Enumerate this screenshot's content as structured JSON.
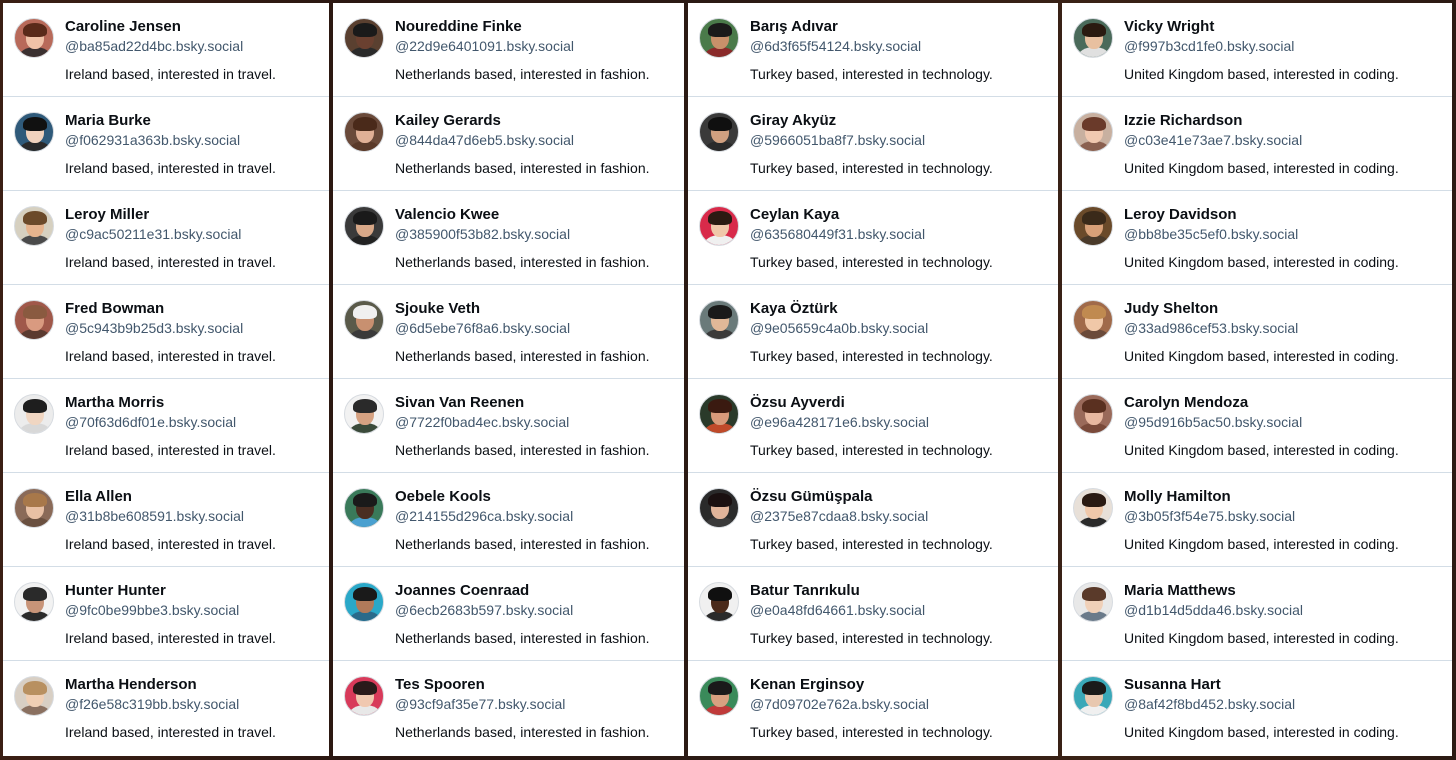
{
  "columns": [
    {
      "accounts": [
        {
          "name": "Caroline Jensen",
          "handle": "@ba85ad22d4bc.bsky.social",
          "bio": "Ireland based, interested in travel.",
          "avatar": {
            "bg": "#b86a5a",
            "skin": "#f0c2a8",
            "hair": "#5a2a1a",
            "shirt": "#3a3030"
          }
        },
        {
          "name": "Maria Burke",
          "handle": "@f062931a363b.bsky.social",
          "bio": "Ireland based, interested in travel.",
          "avatar": {
            "bg": "#2f5a7a",
            "skin": "#f1d2bd",
            "hair": "#111111",
            "shirt": "#2a2a2a"
          }
        },
        {
          "name": "Leroy Miller",
          "handle": "@c9ac50211e31.bsky.social",
          "bio": "Ireland based, interested in travel.",
          "avatar": {
            "bg": "#d6d0c0",
            "skin": "#e6b48e",
            "hair": "#6b4a2a",
            "shirt": "#4a4a4a"
          }
        },
        {
          "name": "Fred Bowman",
          "handle": "@5c943b9b25d3.bsky.social",
          "bio": "Ireland based, interested in travel.",
          "avatar": {
            "bg": "#a0584a",
            "skin": "#d99a80",
            "hair": "#8a5a40",
            "shirt": "#5a3a30"
          }
        },
        {
          "name": "Martha Morris",
          "handle": "@70f63d6df01e.bsky.social",
          "bio": "Ireland based, interested in travel.",
          "avatar": {
            "bg": "#ececec",
            "skin": "#f0d6c2",
            "hair": "#1e1e1e",
            "shirt": "#d8d8d8"
          }
        },
        {
          "name": "Ella Allen",
          "handle": "@31b8be608591.bsky.social",
          "bio": "Ireland based, interested in travel.",
          "avatar": {
            "bg": "#8a6a58",
            "skin": "#e8c0a4",
            "hair": "#a8784a",
            "shirt": "#6a5040"
          }
        },
        {
          "name": "Hunter Hunter",
          "handle": "@9fc0be99bbe3.bsky.social",
          "bio": "Ireland based, interested in travel.",
          "avatar": {
            "bg": "#f2f2f2",
            "skin": "#c89478",
            "hair": "#2a2a2a",
            "shirt": "#2a2a2a"
          }
        },
        {
          "name": "Martha Henderson",
          "handle": "@f26e58c319bb.bsky.social",
          "bio": "Ireland based, interested in travel.",
          "avatar": {
            "bg": "#d8cfc4",
            "skin": "#f0cfb4",
            "hair": "#b89060",
            "shirt": "#8a7060"
          }
        }
      ]
    },
    {
      "accounts": [
        {
          "name": "Noureddine Finke",
          "handle": "@22d9e6401091.bsky.social",
          "bio": "Netherlands based, interested in fashion.",
          "avatar": {
            "bg": "#5a4030",
            "skin": "#6a4030",
            "hair": "#1a1a1a",
            "shirt": "#2a2a2a"
          }
        },
        {
          "name": "Kailey Gerards",
          "handle": "@844da47d6eb5.bsky.social",
          "bio": "Netherlands based, interested in fashion.",
          "avatar": {
            "bg": "#6a4a3a",
            "skin": "#e0b096",
            "hair": "#4a2a1a",
            "shirt": "#5a3a2a"
          }
        },
        {
          "name": "Valencio Kwee",
          "handle": "@385900f53b82.bsky.social",
          "bio": "Netherlands based, interested in fashion.",
          "avatar": {
            "bg": "#3a3a3a",
            "skin": "#d8a888",
            "hair": "#1a1a1a",
            "shirt": "#222222"
          }
        },
        {
          "name": "Sjouke Veth",
          "handle": "@6d5ebe76f8a6.bsky.social",
          "bio": "Netherlands based, interested in fashion.",
          "avatar": {
            "bg": "#5a5a4a",
            "skin": "#c89070",
            "hair": "#f0f0f0",
            "shirt": "#3a3a3a"
          }
        },
        {
          "name": "Sivan Van Reenen",
          "handle": "@7722f0bad4ec.bsky.social",
          "bio": "Netherlands based, interested in fashion.",
          "avatar": {
            "bg": "#f2f2f2",
            "skin": "#d6a282",
            "hair": "#2a2a2a",
            "shirt": "#3a4a3a"
          }
        },
        {
          "name": "Oebele Kools",
          "handle": "@214155d296ca.bsky.social",
          "bio": "Netherlands based, interested in fashion.",
          "avatar": {
            "bg": "#3a7a5a",
            "skin": "#4a2e22",
            "hair": "#1a1a1a",
            "shirt": "#4aa0d0"
          }
        },
        {
          "name": "Joannes Coenraad",
          "handle": "@6ecb2683b597.bsky.social",
          "bio": "Netherlands based, interested in fashion.",
          "avatar": {
            "bg": "#2aa8c8",
            "skin": "#b07a5a",
            "hair": "#1a1a1a",
            "shirt": "#2a6a8a"
          }
        },
        {
          "name": "Tes Spooren",
          "handle": "@93cf9af35e77.bsky.social",
          "bio": "Netherlands based, interested in fashion.",
          "avatar": {
            "bg": "#d83a5a",
            "skin": "#f0c8b0",
            "hair": "#2a1a1a",
            "shirt": "#e8e8e8"
          }
        }
      ]
    },
    {
      "accounts": [
        {
          "name": "Barış Adıvar",
          "handle": "@6d3f65f54124.bsky.social",
          "bio": "Turkey based, interested in technology.",
          "avatar": {
            "bg": "#4a7a4a",
            "skin": "#c8906a",
            "hair": "#1a1a1a",
            "shirt": "#8a2a2a"
          }
        },
        {
          "name": "Giray Akyüz",
          "handle": "@5966051ba8f7.bsky.social",
          "bio": "Turkey based, interested in technology.",
          "avatar": {
            "bg": "#3a3a3a",
            "skin": "#d0a080",
            "hair": "#101010",
            "shirt": "#2a2a2a"
          }
        },
        {
          "name": "Ceylan Kaya",
          "handle": "@635680449f31.bsky.social",
          "bio": "Turkey based, interested in technology.",
          "avatar": {
            "bg": "#d82a4a",
            "skin": "#f0c8aa",
            "hair": "#2a1a12",
            "shirt": "#f0f0f0"
          }
        },
        {
          "name": "Kaya Öztürk",
          "handle": "@9e05659c4a0b.bsky.social",
          "bio": "Turkey based, interested in technology.",
          "avatar": {
            "bg": "#6a7a7a",
            "skin": "#e0b898",
            "hair": "#1a1a1a",
            "shirt": "#3a3a3a"
          }
        },
        {
          "name": "Özsu Ayverdi",
          "handle": "@e96a428171e6.bsky.social",
          "bio": "Turkey based, interested in technology.",
          "avatar": {
            "bg": "#2a3a2a",
            "skin": "#d89a7a",
            "hair": "#3a1a10",
            "shirt": "#c04a2a"
          }
        },
        {
          "name": "Özsu Gümüşpala",
          "handle": "@2375e87cdaa8.bsky.social",
          "bio": "Turkey based, interested in technology.",
          "avatar": {
            "bg": "#2a2a2a",
            "skin": "#e0b49a",
            "hair": "#1a1010",
            "shirt": "#3a3a3a"
          }
        },
        {
          "name": "Batur Tanrıkulu",
          "handle": "@e0a48fd64661.bsky.social",
          "bio": "Turkey based, interested in technology.",
          "avatar": {
            "bg": "#f0f0f0",
            "skin": "#4a2a1a",
            "hair": "#101010",
            "shirt": "#2a2a2a"
          }
        },
        {
          "name": "Kenan Erginsoy",
          "handle": "@7d09702e762a.bsky.social",
          "bio": "Turkey based, interested in technology.",
          "avatar": {
            "bg": "#3a8a5a",
            "skin": "#d8a080",
            "hair": "#1a1a1a",
            "shirt": "#c03a3a"
          }
        }
      ]
    },
    {
      "accounts": [
        {
          "name": "Vicky Wright",
          "handle": "@f997b3cd1fe0.bsky.social",
          "bio": "United Kingdom based, interested in coding.",
          "avatar": {
            "bg": "#4a6a5a",
            "skin": "#e8c0a0",
            "hair": "#2a1a10",
            "shirt": "#e0e0e0"
          }
        },
        {
          "name": "Izzie Richardson",
          "handle": "@c03e41e73ae7.bsky.social",
          "bio": "United Kingdom based, interested in coding.",
          "avatar": {
            "bg": "#c8b0a0",
            "skin": "#f0c8b0",
            "hair": "#6a3a2a",
            "shirt": "#8a6050"
          }
        },
        {
          "name": "Leroy Davidson",
          "handle": "@bb8be35c5ef0.bsky.social",
          "bio": "United Kingdom based, interested in coding.",
          "avatar": {
            "bg": "#6a4a2a",
            "skin": "#d8a078",
            "hair": "#3a2a1a",
            "shirt": "#4a3a2a"
          }
        },
        {
          "name": "Judy Shelton",
          "handle": "@33ad986cef53.bsky.social",
          "bio": "United Kingdom based, interested in coding.",
          "avatar": {
            "bg": "#a06a4a",
            "skin": "#f0c8a8",
            "hair": "#c08a50",
            "shirt": "#6a4a3a"
          }
        },
        {
          "name": "Carolyn Mendoza",
          "handle": "@95d916b5ac50.bsky.social",
          "bio": "United Kingdom based, interested in coding.",
          "avatar": {
            "bg": "#9a6a5a",
            "skin": "#e8b8a0",
            "hair": "#5a3020",
            "shirt": "#7a4a3a"
          }
        },
        {
          "name": "Molly Hamilton",
          "handle": "@3b05f3f54e75.bsky.social",
          "bio": "United Kingdom based, interested in coding.",
          "avatar": {
            "bg": "#e8e0d8",
            "skin": "#f0c8aa",
            "hair": "#2a1a12",
            "shirt": "#2a2a2a"
          }
        },
        {
          "name": "Maria Matthews",
          "handle": "@d1b14d5dda46.bsky.social",
          "bio": "United Kingdom based, interested in coding.",
          "avatar": {
            "bg": "#e8e8e8",
            "skin": "#f0d0b8",
            "hair": "#5a3a2a",
            "shirt": "#6a7a8a"
          }
        },
        {
          "name": "Susanna Hart",
          "handle": "@8af42f8bd452.bsky.social",
          "bio": "United Kingdom based, interested in coding.",
          "avatar": {
            "bg": "#3aa8b8",
            "skin": "#e8c8b0",
            "hair": "#1a1a1a",
            "shirt": "#f0f0f0"
          }
        }
      ]
    }
  ]
}
